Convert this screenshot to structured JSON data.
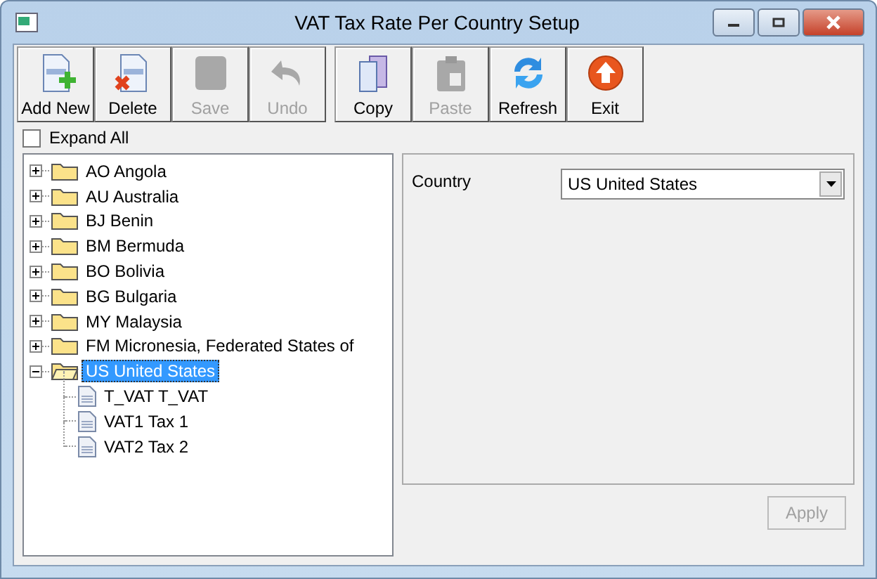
{
  "window": {
    "title": "VAT Tax Rate Per Country Setup"
  },
  "toolbar": [
    {
      "kind": "add",
      "label": "Add New",
      "disabled": false
    },
    {
      "kind": "delete",
      "label": "Delete",
      "disabled": false
    },
    {
      "kind": "save",
      "label": "Save",
      "disabled": true
    },
    {
      "kind": "undo",
      "label": "Undo",
      "disabled": true
    },
    {
      "kind": "copy",
      "label": "Copy",
      "disabled": false
    },
    {
      "kind": "paste",
      "label": "Paste",
      "disabled": true
    },
    {
      "kind": "refresh",
      "label": "Refresh",
      "disabled": false
    },
    {
      "kind": "exit",
      "label": "Exit",
      "disabled": false
    }
  ],
  "expand_all": {
    "label": "Expand All",
    "checked": false
  },
  "tree": [
    {
      "label": "AO Angola",
      "expanded": false,
      "selected": false
    },
    {
      "label": "AU Australia",
      "expanded": false,
      "selected": false
    },
    {
      "label": "BJ Benin",
      "expanded": false,
      "selected": false
    },
    {
      "label": "BM Bermuda",
      "expanded": false,
      "selected": false
    },
    {
      "label": "BO Bolivia",
      "expanded": false,
      "selected": false
    },
    {
      "label": "BG Bulgaria",
      "expanded": false,
      "selected": false
    },
    {
      "label": "MY Malaysia",
      "expanded": false,
      "selected": false
    },
    {
      "label": "FM Micronesia, Federated States of",
      "expanded": false,
      "selected": false
    },
    {
      "label": "US United States",
      "expanded": true,
      "selected": true,
      "children": [
        {
          "label": "T_VAT T_VAT",
          "selected": false
        },
        {
          "label": "VAT1 Tax 1",
          "selected": false
        },
        {
          "label": "VAT2 Tax 2",
          "selected": false
        }
      ]
    }
  ],
  "form": {
    "country_label": "Country",
    "country_value": "US United States"
  },
  "apply_button": {
    "label": "Apply",
    "disabled": true
  }
}
